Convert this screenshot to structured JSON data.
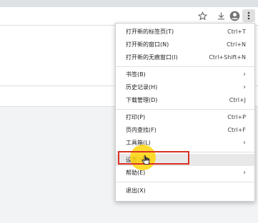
{
  "toolbar": {
    "icons": [
      "star-icon",
      "download-icon",
      "avatar-icon",
      "menu-kebab-icon"
    ]
  },
  "colors": {
    "highlight_box": "#d93025",
    "cursor_glow": "#ffd60a",
    "menu_bg": "#ffffff",
    "hover_bg": "#e8e8e8"
  },
  "menu": {
    "items": [
      {
        "label": "打开新的标签页(T)",
        "shortcut": "Ctrl+T"
      },
      {
        "label": "打开新的窗口(N)",
        "shortcut": "Ctrl+N"
      },
      {
        "label": "打开新的无痕窗口(I)",
        "shortcut": "Ctrl+Shift+N"
      },
      {
        "label": "书签(B)",
        "shortcut": ""
      },
      {
        "label": "历史记录(H)",
        "shortcut": ""
      },
      {
        "label": "下载管理(D)",
        "shortcut": "Ctrl+J"
      },
      {
        "label": "打印(P)",
        "shortcut": "Ctrl+P"
      },
      {
        "label": "页内查找(F)",
        "shortcut": "Ctrl+F"
      },
      {
        "label": "工具箱(L)",
        "shortcut": ""
      },
      {
        "label": "设置(S)",
        "shortcut": ""
      },
      {
        "label": "帮助(E)",
        "shortcut": ""
      },
      {
        "label": "退出(X)",
        "shortcut": ""
      }
    ]
  }
}
